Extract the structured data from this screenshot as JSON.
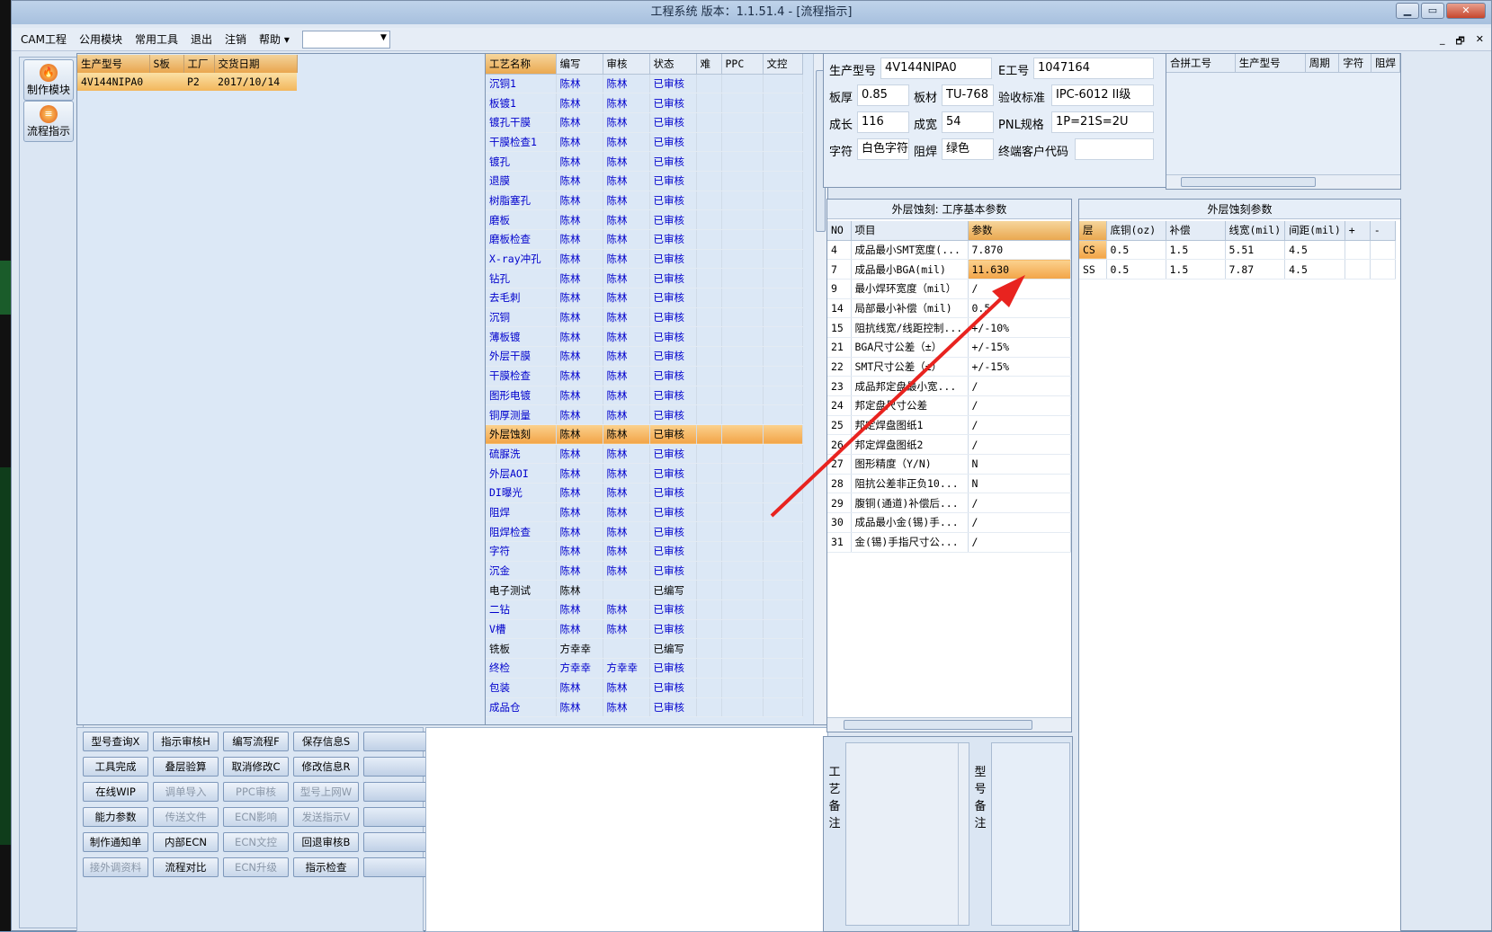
{
  "window": {
    "title": "工程系统   版本：1.1.51.4 - [流程指示]",
    "min": "▁",
    "max": "▭",
    "close": "✕"
  },
  "menu": [
    "CAM工程",
    "公用模块",
    "常用工具",
    "退出",
    "注销",
    "帮助"
  ],
  "mdi_controls": [
    "_",
    "🗗",
    "✕"
  ],
  "nav": [
    {
      "label": "制作模块",
      "icon": "fire-icon"
    },
    {
      "label": "流程指示",
      "icon": "flow-icon"
    }
  ],
  "orders": {
    "columns": [
      "生产型号",
      "S板",
      "工厂",
      "交货日期"
    ],
    "rows": [
      [
        "4V144NIPA0",
        "",
        "P2",
        "2017/10/14"
      ]
    ]
  },
  "process": {
    "columns": [
      "工艺名称",
      "编写",
      "审核",
      "状态",
      "难",
      "PPC",
      "文控"
    ],
    "rows": [
      [
        "沉铜1",
        "陈林",
        "陈林",
        "已审核"
      ],
      [
        "板镀1",
        "陈林",
        "陈林",
        "已审核"
      ],
      [
        "镀孔干膜",
        "陈林",
        "陈林",
        "已审核"
      ],
      [
        "干膜检查1",
        "陈林",
        "陈林",
        "已审核"
      ],
      [
        "镀孔",
        "陈林",
        "陈林",
        "已审核"
      ],
      [
        "退膜",
        "陈林",
        "陈林",
        "已审核"
      ],
      [
        "树脂塞孔",
        "陈林",
        "陈林",
        "已审核"
      ],
      [
        "磨板",
        "陈林",
        "陈林",
        "已审核"
      ],
      [
        "磨板检查",
        "陈林",
        "陈林",
        "已审核"
      ],
      [
        "X-ray冲孔",
        "陈林",
        "陈林",
        "已审核"
      ],
      [
        "钻孔",
        "陈林",
        "陈林",
        "已审核"
      ],
      [
        "去毛刺",
        "陈林",
        "陈林",
        "已审核"
      ],
      [
        "沉铜",
        "陈林",
        "陈林",
        "已审核"
      ],
      [
        "薄板镀",
        "陈林",
        "陈林",
        "已审核"
      ],
      [
        "外层干膜",
        "陈林",
        "陈林",
        "已审核"
      ],
      [
        "干膜检查",
        "陈林",
        "陈林",
        "已审核"
      ],
      [
        "图形电镀",
        "陈林",
        "陈林",
        "已审核"
      ],
      [
        "铜厚测量",
        "陈林",
        "陈林",
        "已审核"
      ],
      [
        "外层蚀刻",
        "陈林",
        "陈林",
        "已审核"
      ],
      [
        "硫脲洗",
        "陈林",
        "陈林",
        "已审核"
      ],
      [
        "外层AOI",
        "陈林",
        "陈林",
        "已审核"
      ],
      [
        "DI曝光",
        "陈林",
        "陈林",
        "已审核"
      ],
      [
        "阻焊",
        "陈林",
        "陈林",
        "已审核"
      ],
      [
        "阻焊检查",
        "陈林",
        "陈林",
        "已审核"
      ],
      [
        "字符",
        "陈林",
        "陈林",
        "已审核"
      ],
      [
        "沉金",
        "陈林",
        "陈林",
        "已审核"
      ],
      [
        "电子测试",
        "陈林",
        "",
        "已编写"
      ],
      [
        "二钻",
        "陈林",
        "陈林",
        "已审核"
      ],
      [
        "V槽",
        "陈林",
        "陈林",
        "已审核"
      ],
      [
        "铣板",
        "方幸幸",
        "",
        "已编写"
      ],
      [
        "终检",
        "方幸幸",
        "方幸幸",
        "已审核"
      ],
      [
        "包装",
        "陈林",
        "陈林",
        "已审核"
      ],
      [
        "成品仓",
        "陈林",
        "陈林",
        "已审核"
      ]
    ]
  },
  "buttons": [
    [
      "型号查询X",
      "指示审核H",
      "编写流程F",
      "保存信息S",
      ""
    ],
    [
      "工具完成",
      "叠层验算",
      "取消修改C",
      "修改信息R",
      ""
    ],
    [
      "在线WIP",
      "调单导入",
      "PPC审核",
      "型号上网W",
      ""
    ],
    [
      "能力参数",
      "传送文件",
      "ECN影响",
      "发送指示V",
      ""
    ],
    [
      "制作通知单",
      "内部ECN",
      "ECN文控",
      "回退审核B",
      ""
    ],
    [
      "接外调资料",
      "流程对比",
      "ECN升级",
      "指示检查",
      ""
    ]
  ],
  "info": {
    "型号label": "生产型号",
    "型号": "4V144NIPA0",
    "E工号label": "E工号",
    "E工号": "1047164",
    "板厚label": "板厚",
    "板厚": "0.85",
    "板材label": "板材",
    "板材": "TU-768",
    "验收label": "验收标准",
    "验收": "IPC-6012 II级",
    "成长label": "成长",
    "成长": "116",
    "成宽label": "成宽",
    "成宽": "54",
    "PNLlabel": "PNL规格",
    "PNL": "1P=21S=2U",
    "字符label": "字符",
    "字符": "白色字符",
    "阻焊label": "阻焊",
    "阻焊": "绿色",
    "终端label": "终端客户代码",
    "终端": ""
  },
  "merge": {
    "columns": [
      "合拼工号",
      "生产型号",
      "周期",
      "字符",
      "阻焊"
    ]
  },
  "basic": {
    "title": "外层蚀刻: 工序基本参数",
    "columns": [
      "NO",
      "项目",
      "参数"
    ],
    "rows": [
      [
        "4",
        "成品最小SMT宽度(...",
        "7.870"
      ],
      [
        "7",
        "成品最小BGA(mil)",
        "11.630"
      ],
      [
        "9",
        "最小焊环宽度（mil）",
        "/"
      ],
      [
        "14",
        "局部最小补偿（mil)",
        "0.5"
      ],
      [
        "15",
        "阻抗线宽/线距控制...",
        "+/-10%"
      ],
      [
        "21",
        "BGA尺寸公差（±）",
        "+/-15%"
      ],
      [
        "22",
        "SMT尺寸公差（±）",
        "+/-15%"
      ],
      [
        "23",
        "成品邦定盘最小宽...",
        "/"
      ],
      [
        "24",
        "邦定盘尺寸公差",
        "/"
      ],
      [
        "25",
        "邦定焊盘图纸1",
        "/"
      ],
      [
        "26",
        "邦定焊盘图纸2",
        "/"
      ],
      [
        "27",
        "图形精度（Y/N)",
        "N"
      ],
      [
        "28",
        "阻抗公差非正负10...",
        "N"
      ],
      [
        "29",
        "腹铜(通道)补偿后...",
        "/"
      ],
      [
        "30",
        "成品最小金(锡)手...",
        "/"
      ],
      [
        "31",
        "金(锡)手指尺寸公...",
        "/"
      ]
    ]
  },
  "etch": {
    "title": "外层蚀刻参数",
    "columns": [
      "层",
      "底铜(oz)",
      "补偿",
      "线宽(mil)",
      "间距(mil)",
      "+",
      "-"
    ],
    "rows": [
      [
        "CS",
        "0.5",
        "1.5",
        "5.51",
        "4.5"
      ],
      [
        "SS",
        "0.5",
        "1.5",
        "7.87",
        "4.5"
      ]
    ]
  },
  "notes": {
    "process_label": "工艺备注",
    "model_label": "型号备注"
  },
  "colors": {
    "accent": "#f2a447",
    "link": "#0000cc",
    "arrow": "#e8231f"
  }
}
